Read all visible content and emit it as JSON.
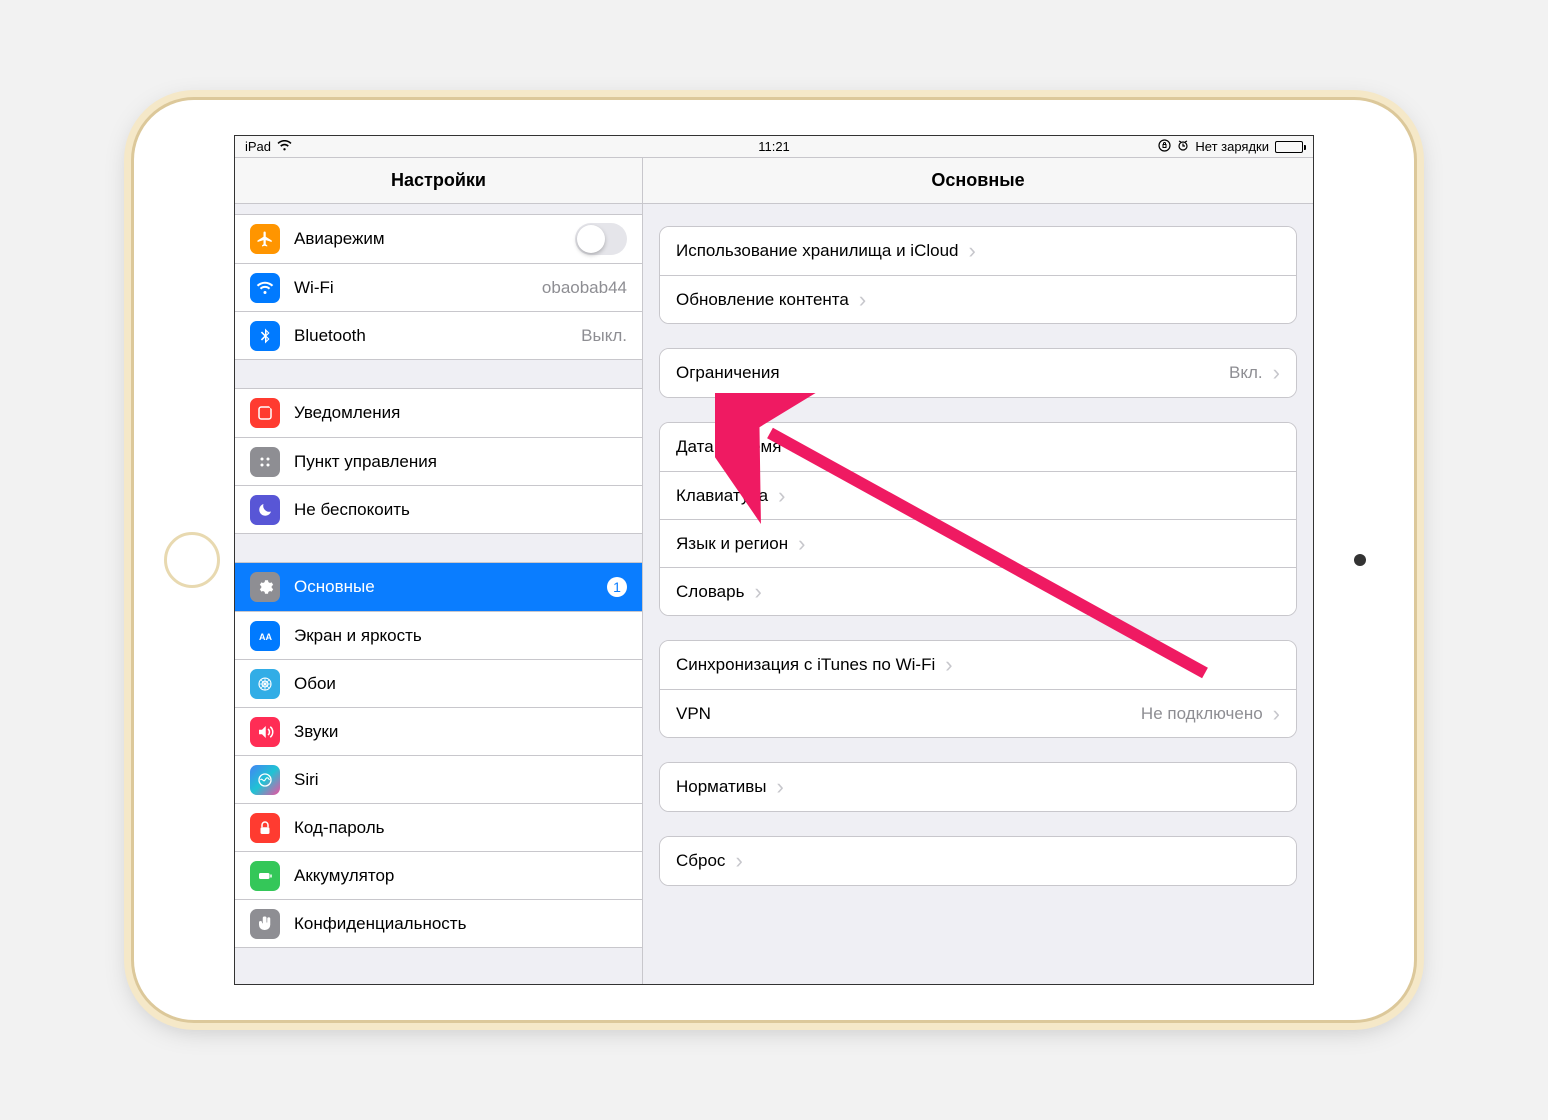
{
  "statusbar": {
    "device": "iPad",
    "time": "11:21",
    "charge_text": "Нет зарядки"
  },
  "sidebar": {
    "title": "Настройки",
    "groups": [
      {
        "items": [
          {
            "id": "airplane",
            "label": "Авиарежим",
            "icon": "airplane-icon",
            "type": "toggle",
            "value": false
          },
          {
            "id": "wifi",
            "label": "Wi-Fi",
            "icon": "wifi-icon",
            "subtitle": "obaobab44"
          },
          {
            "id": "bluetooth",
            "label": "Bluetooth",
            "icon": "bluetooth-icon",
            "subtitle": "Выкл."
          }
        ]
      },
      {
        "items": [
          {
            "id": "notifications",
            "label": "Уведомления",
            "icon": "notifications-icon",
            "has_dot": true
          },
          {
            "id": "control-center",
            "label": "Пункт управления",
            "icon": "control-center-icon"
          },
          {
            "id": "dnd",
            "label": "Не беспокоить",
            "icon": "moon-icon"
          }
        ]
      },
      {
        "items": [
          {
            "id": "general",
            "label": "Основные",
            "icon": "gear-icon",
            "selected": true,
            "badge": "1"
          },
          {
            "id": "display",
            "label": "Экран и яркость",
            "icon": "display-icon"
          },
          {
            "id": "wallpaper",
            "label": "Обои",
            "icon": "wallpaper-icon"
          },
          {
            "id": "sounds",
            "label": "Звуки",
            "icon": "sounds-icon"
          },
          {
            "id": "siri",
            "label": "Siri",
            "icon": "siri-icon"
          },
          {
            "id": "passcode",
            "label": "Код-пароль",
            "icon": "lock-icon"
          },
          {
            "id": "battery",
            "label": "Аккумулятор",
            "icon": "battery-icon"
          },
          {
            "id": "privacy",
            "label": "Конфиденциальность",
            "icon": "hand-icon"
          }
        ]
      }
    ]
  },
  "detail": {
    "title": "Основные",
    "groups": [
      {
        "items": [
          {
            "id": "storage",
            "label": "Использование хранилища и iCloud"
          },
          {
            "id": "bgrefresh",
            "label": "Обновление контента"
          }
        ]
      },
      {
        "items": [
          {
            "id": "restrictions",
            "label": "Ограничения",
            "subtitle": "Вкл."
          }
        ]
      },
      {
        "items": [
          {
            "id": "datetime",
            "label": "Дата и время"
          },
          {
            "id": "keyboard",
            "label": "Клавиатура"
          },
          {
            "id": "language",
            "label": "Язык и регион"
          },
          {
            "id": "dictionary",
            "label": "Словарь"
          }
        ]
      },
      {
        "items": [
          {
            "id": "itunes-sync",
            "label": "Синхронизация с iTunes по Wi-Fi"
          },
          {
            "id": "vpn",
            "label": "VPN",
            "subtitle": "Не подключено"
          }
        ]
      },
      {
        "items": [
          {
            "id": "regulatory",
            "label": "Нормативы"
          }
        ]
      },
      {
        "items": [
          {
            "id": "reset",
            "label": "Сброс"
          }
        ]
      }
    ]
  }
}
